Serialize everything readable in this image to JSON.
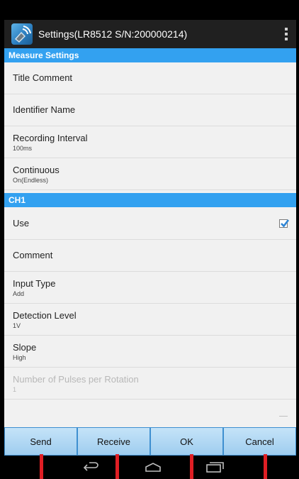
{
  "app": {
    "title": "Settings(LR8512 S/N:200000214)"
  },
  "sections": {
    "measure": "Measure Settings",
    "ch1": "CH1"
  },
  "measure_items": [
    {
      "title": "Title Comment",
      "sub": ""
    },
    {
      "title": "Identifier Name",
      "sub": ""
    },
    {
      "title": "Recording Interval",
      "sub": "100ms"
    },
    {
      "title": "Continuous",
      "sub": "On(Endless)"
    }
  ],
  "ch1_items": [
    {
      "title": "Use",
      "checked": true
    },
    {
      "title": "Comment",
      "sub": ""
    },
    {
      "title": "Input Type",
      "sub": "Add"
    },
    {
      "title": "Detection Level",
      "sub": "1V"
    },
    {
      "title": "Slope",
      "sub": "High"
    },
    {
      "title": "Number of Pulses per Rotation",
      "sub": "1",
      "disabled": true
    }
  ],
  "buttons": {
    "send": "Send",
    "receive": "Receive",
    "ok": "OK",
    "cancel": "Cancel"
  },
  "icons": {
    "app": "logger-app-icon",
    "overflow": "overflow-menu-icon",
    "back": "back-icon",
    "home": "home-icon",
    "recents": "recent-apps-icon"
  },
  "colors": {
    "section_header": "#33a1f0",
    "action_bar": "#202020",
    "button_fill": "#b3dbf6",
    "checkbox_check": "#2f86d6",
    "marker": "#e01e24"
  }
}
